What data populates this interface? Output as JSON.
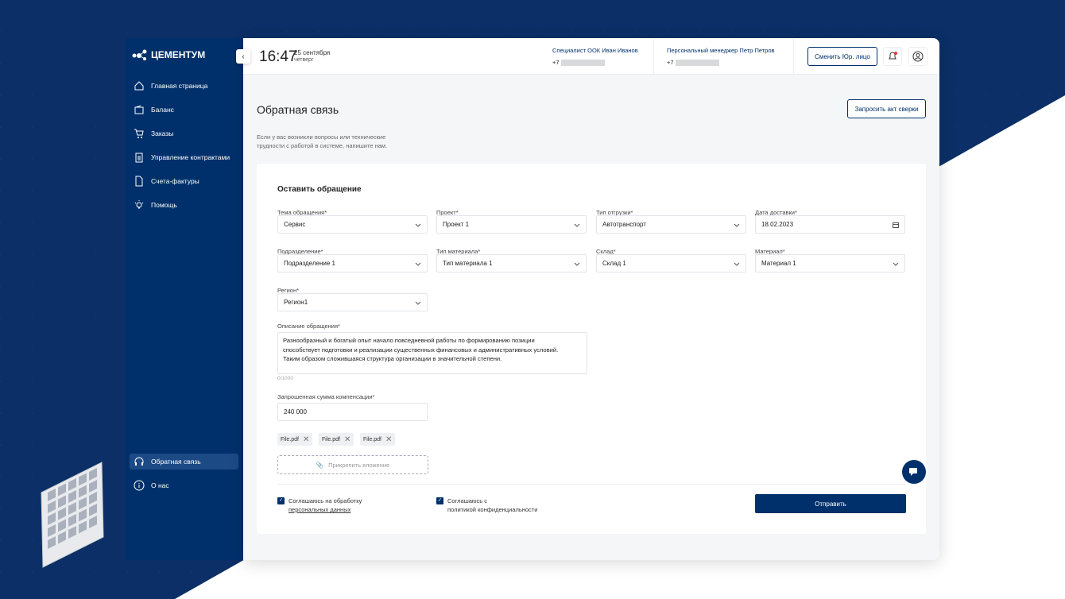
{
  "brand": "ЦЕМЕНТУМ",
  "sidebar": {
    "items": [
      {
        "label": "Главная страница",
        "icon": "home-icon"
      },
      {
        "label": "Баланс",
        "icon": "wallet-icon"
      },
      {
        "label": "Заказы",
        "icon": "cart-icon"
      },
      {
        "label": "Управление контрактами",
        "icon": "clipboard-icon"
      },
      {
        "label": "Счета-фактуры",
        "icon": "document-icon"
      },
      {
        "label": "Помощь",
        "icon": "lightbulb-icon"
      }
    ],
    "bottom": [
      {
        "label": "Обратная связь",
        "icon": "headset-icon",
        "active": true
      },
      {
        "label": "О нас",
        "icon": "info-icon"
      }
    ]
  },
  "header": {
    "time": "16:47",
    "date": "25 сентября",
    "weekday": "четверг",
    "contacts": [
      {
        "title": "Специалист ООК Иван Иванов",
        "phone": "+7"
      },
      {
        "title": "Персональный менеджер Петр Петров",
        "phone": "+7"
      }
    ],
    "switch_label": "Сменить Юр. лицо"
  },
  "page": {
    "title": "Обратная связь",
    "request_act": "Запросить акт сверки",
    "intro_1": "Если у вас возникли вопросы или технические",
    "intro_2": "трудности с работой в системе, напишите нам."
  },
  "form": {
    "title": "Оставить обращение",
    "fields": [
      {
        "label": "Тема обращения*",
        "value": "Сервис"
      },
      {
        "label": "Проект*",
        "value": "Проект 1"
      },
      {
        "label": "Тип отгрузки*",
        "value": "Автотранспорт"
      },
      {
        "label": "Дата доставки*",
        "value": "18.02.2023"
      },
      {
        "label": "Подразделение*",
        "value": "Подразделение 1"
      },
      {
        "label": "Тип материала*",
        "value": "Тип материала 1"
      },
      {
        "label": "Склад*",
        "value": "Склад 1"
      },
      {
        "label": "Материал*",
        "value": "Материал 1"
      },
      {
        "label": "Регион*",
        "value": "Регион1"
      }
    ],
    "description_label": "Описание обращения*",
    "description_lines": [
      "Разнообразный и богатый опыт начало повседневной работы по формированию позиции",
      "способствует подготовки и реализации существенных финансовых и административных условий.",
      "Таким образом сложившаяся структура организации в значительной степени."
    ],
    "counter": "0/1000",
    "amount_label": "Запрошенная сумма компенсации*",
    "amount": "240 000",
    "files": [
      "File.pdf",
      "File.pdf",
      "File.pdf"
    ],
    "attach": "Прикрепить вложение",
    "consent1_a": "Соглашаюсь на обработку",
    "consent1_b": "персональных данных",
    "consent2_a": "Соглашаюсь с",
    "consent2_b": "политикой конфиденциальности",
    "submit": "Отправить"
  }
}
